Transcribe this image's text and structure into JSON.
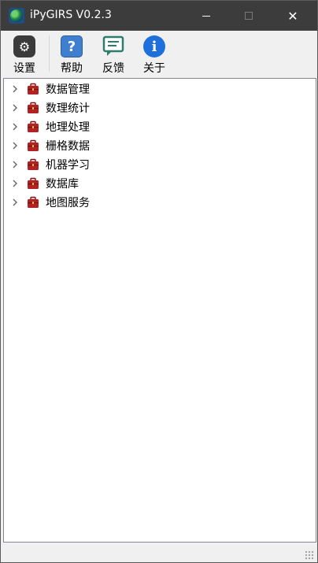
{
  "window": {
    "title": "iPyGIRS V0.2.3"
  },
  "title_bar": {
    "app_icon": "globe-icon",
    "minimize_icon": "minimize-icon",
    "maximize_icon": "maximize-icon",
    "close_icon": "close-icon",
    "close_glyph": "✕"
  },
  "toolbar": {
    "settings": {
      "label": "设置",
      "icon": "gear-icon",
      "glyph": "⚙"
    },
    "help": {
      "label": "帮助",
      "icon": "question-icon",
      "glyph": "?"
    },
    "feedback": {
      "label": "反馈",
      "icon": "chat-icon"
    },
    "about": {
      "label": "关于",
      "icon": "info-icon",
      "glyph": "i"
    }
  },
  "tree": {
    "items": [
      {
        "label": "数据管理",
        "icon": "toolbox-icon",
        "expander": "chevron-right-icon"
      },
      {
        "label": "数理统计",
        "icon": "toolbox-icon",
        "expander": "chevron-right-icon"
      },
      {
        "label": "地理处理",
        "icon": "toolbox-icon",
        "expander": "chevron-right-icon"
      },
      {
        "label": "栅格数据",
        "icon": "toolbox-icon",
        "expander": "chevron-right-icon"
      },
      {
        "label": "机器学习",
        "icon": "toolbox-icon",
        "expander": "chevron-right-icon"
      },
      {
        "label": "数据库",
        "icon": "toolbox-icon",
        "expander": "chevron-right-icon"
      },
      {
        "label": "地图服务",
        "icon": "toolbox-icon",
        "expander": "chevron-right-icon"
      }
    ]
  },
  "colors": {
    "titlebar_bg": "#3c3c3c",
    "toolbox_red": "#b22222",
    "help_blue": "#3f7fd0",
    "info_blue": "#1e6fd9",
    "feedback_green": "#2e7d6b"
  }
}
